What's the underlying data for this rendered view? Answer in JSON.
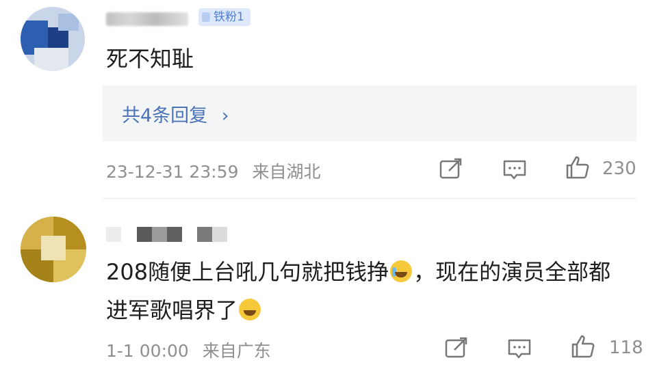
{
  "comments": [
    {
      "username": "· · ·",
      "badge": "铁粉1",
      "text": "死不知耻",
      "replies_label": "共4条回复",
      "replies_chevron": "›",
      "date": "23-12-31 23:59",
      "location": "来自湖北",
      "likes": "230"
    },
    {
      "username": "",
      "text_part1": "208随便上台吼几句就把钱挣",
      "text_part2": "，现在的演员全部都进军歌唱界了",
      "date": "1-1 00:00",
      "location": "来自广东",
      "likes": "118"
    }
  ],
  "icons": {
    "share": "share-icon",
    "comment": "comment-icon",
    "like": "thumbs-up-icon",
    "emoji_laugh": "laugh-cry-emoji-icon",
    "emoji_sweat": "sweat-emoji-icon"
  },
  "colors": {
    "accent": "#4a73b8",
    "meta_text": "#8f8f8f",
    "reply_bg": "#f4f5f7",
    "badge_bg": "#dde8fa"
  }
}
